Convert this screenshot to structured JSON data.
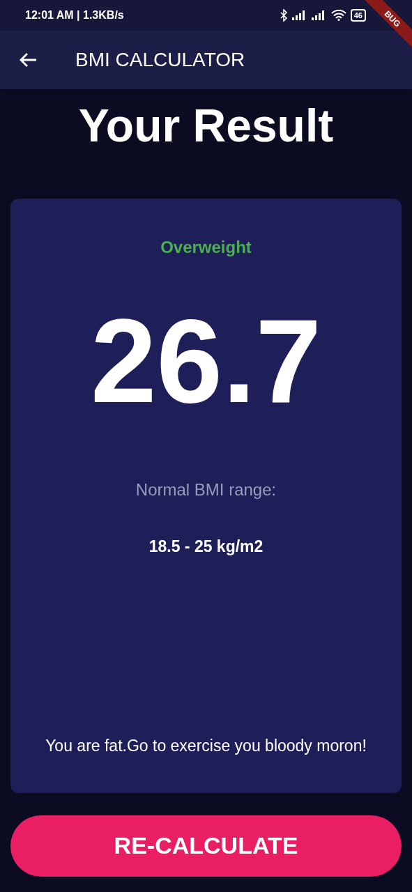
{
  "status_bar": {
    "time": "12:01 AM | 1.3KB/s",
    "battery": "46"
  },
  "debug_banner": "BUG",
  "app_bar": {
    "title": "BMI CALCULATOR"
  },
  "heading": "Your Result",
  "result_card": {
    "category": "Overweight",
    "color": "#4caf50",
    "bmi": "26.7",
    "range_label": "Normal BMI range:",
    "range_value": "18.5 - 25 kg/m2",
    "advice": "You are fat.Go to exercise you bloody moron!"
  },
  "button": "RE-CALCULATE"
}
